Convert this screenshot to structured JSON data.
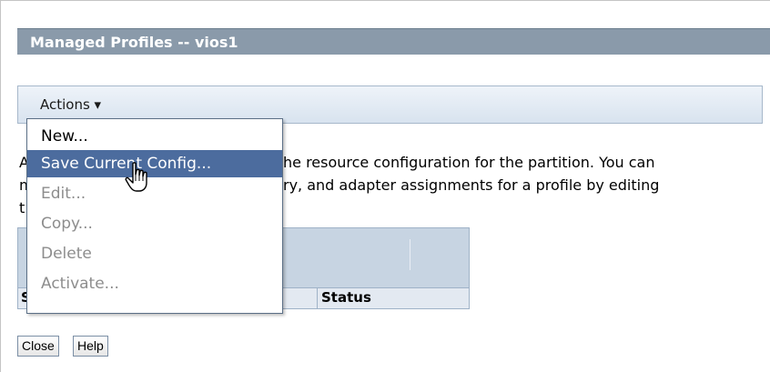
{
  "window": {
    "title": "Managed Profiles -- vios1"
  },
  "actions": {
    "label": "Actions ▾"
  },
  "description": {
    "line1": "The resource configuration for the partition. You can",
    "line2": "ry, and adapter assignments for a profile by editing",
    "line3": "t"
  },
  "table": {
    "columns": [
      "S",
      "Status"
    ]
  },
  "menu": {
    "items": [
      {
        "label": "New...",
        "state": "enabled"
      },
      {
        "label": "Save Current Config...",
        "state": "hover"
      },
      {
        "label": "Edit...",
        "state": "disabled"
      },
      {
        "label": "Copy...",
        "state": "disabled"
      },
      {
        "label": "Delete",
        "state": "disabled"
      },
      {
        "label": "Activate...",
        "state": "disabled"
      }
    ]
  },
  "buttons": {
    "close": "Close",
    "help": "Help"
  },
  "colors": {
    "title_bar": "#8a9aaa",
    "menu_highlight": "#4c6c9e",
    "table_header": "#c7d4e2"
  }
}
